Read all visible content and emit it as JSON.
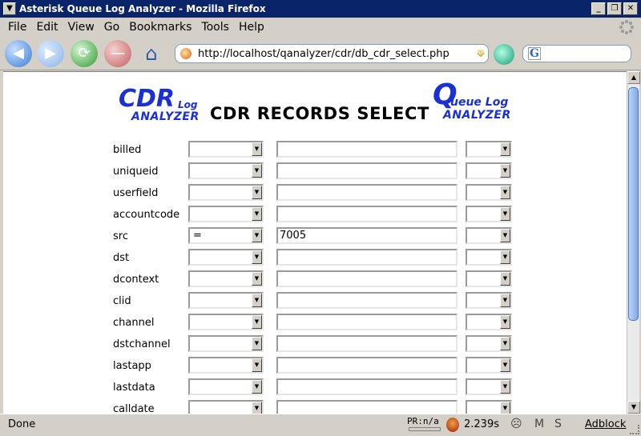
{
  "window": {
    "title": "Asterisk Queue Log Analyzer - Mozilla Firefox",
    "sysmenu_icon": "chevron-down-icon",
    "buttons": {
      "minimize": "_",
      "maximize": "❐",
      "close": "✕"
    }
  },
  "menu": {
    "items": [
      "File",
      "Edit",
      "View",
      "Go",
      "Bookmarks",
      "Tools",
      "Help"
    ]
  },
  "navbar": {
    "url": "http://localhost/qanalyzer/cdr/db_cdr_select.php",
    "search_engine_letter": "G",
    "search_value": ""
  },
  "page": {
    "title": "CDR RECORDS SELECT",
    "logo_left": {
      "big": "CDR",
      "small": "Log",
      "sub": "ANALYZER"
    },
    "logo_right": {
      "big": "Q",
      "small": "ueue Log",
      "sub": "ANALYZER"
    },
    "fields": [
      {
        "label": "billed",
        "operator": "",
        "value": "",
        "order": ""
      },
      {
        "label": "uniqueid",
        "operator": "",
        "value": "",
        "order": ""
      },
      {
        "label": "userfield",
        "operator": "",
        "value": "",
        "order": ""
      },
      {
        "label": "accountcode",
        "operator": "",
        "value": "",
        "order": ""
      },
      {
        "label": "src",
        "operator": "=",
        "value": "7005",
        "order": ""
      },
      {
        "label": "dst",
        "operator": "",
        "value": "",
        "order": ""
      },
      {
        "label": "dcontext",
        "operator": "",
        "value": "",
        "order": ""
      },
      {
        "label": "clid",
        "operator": "",
        "value": "",
        "order": ""
      },
      {
        "label": "channel",
        "operator": "",
        "value": "",
        "order": ""
      },
      {
        "label": "dstchannel",
        "operator": "",
        "value": "",
        "order": ""
      },
      {
        "label": "lastapp",
        "operator": "",
        "value": "",
        "order": ""
      },
      {
        "label": "lastdata",
        "operator": "",
        "value": "",
        "order": ""
      },
      {
        "label": "calldate",
        "operator": "",
        "value": "",
        "order": ""
      }
    ]
  },
  "statusbar": {
    "status": "Done",
    "pr": "PR:n/a",
    "time": "2.239s",
    "adblock": "Adblock",
    "mail_icon": "M",
    "s_icon": "S"
  }
}
